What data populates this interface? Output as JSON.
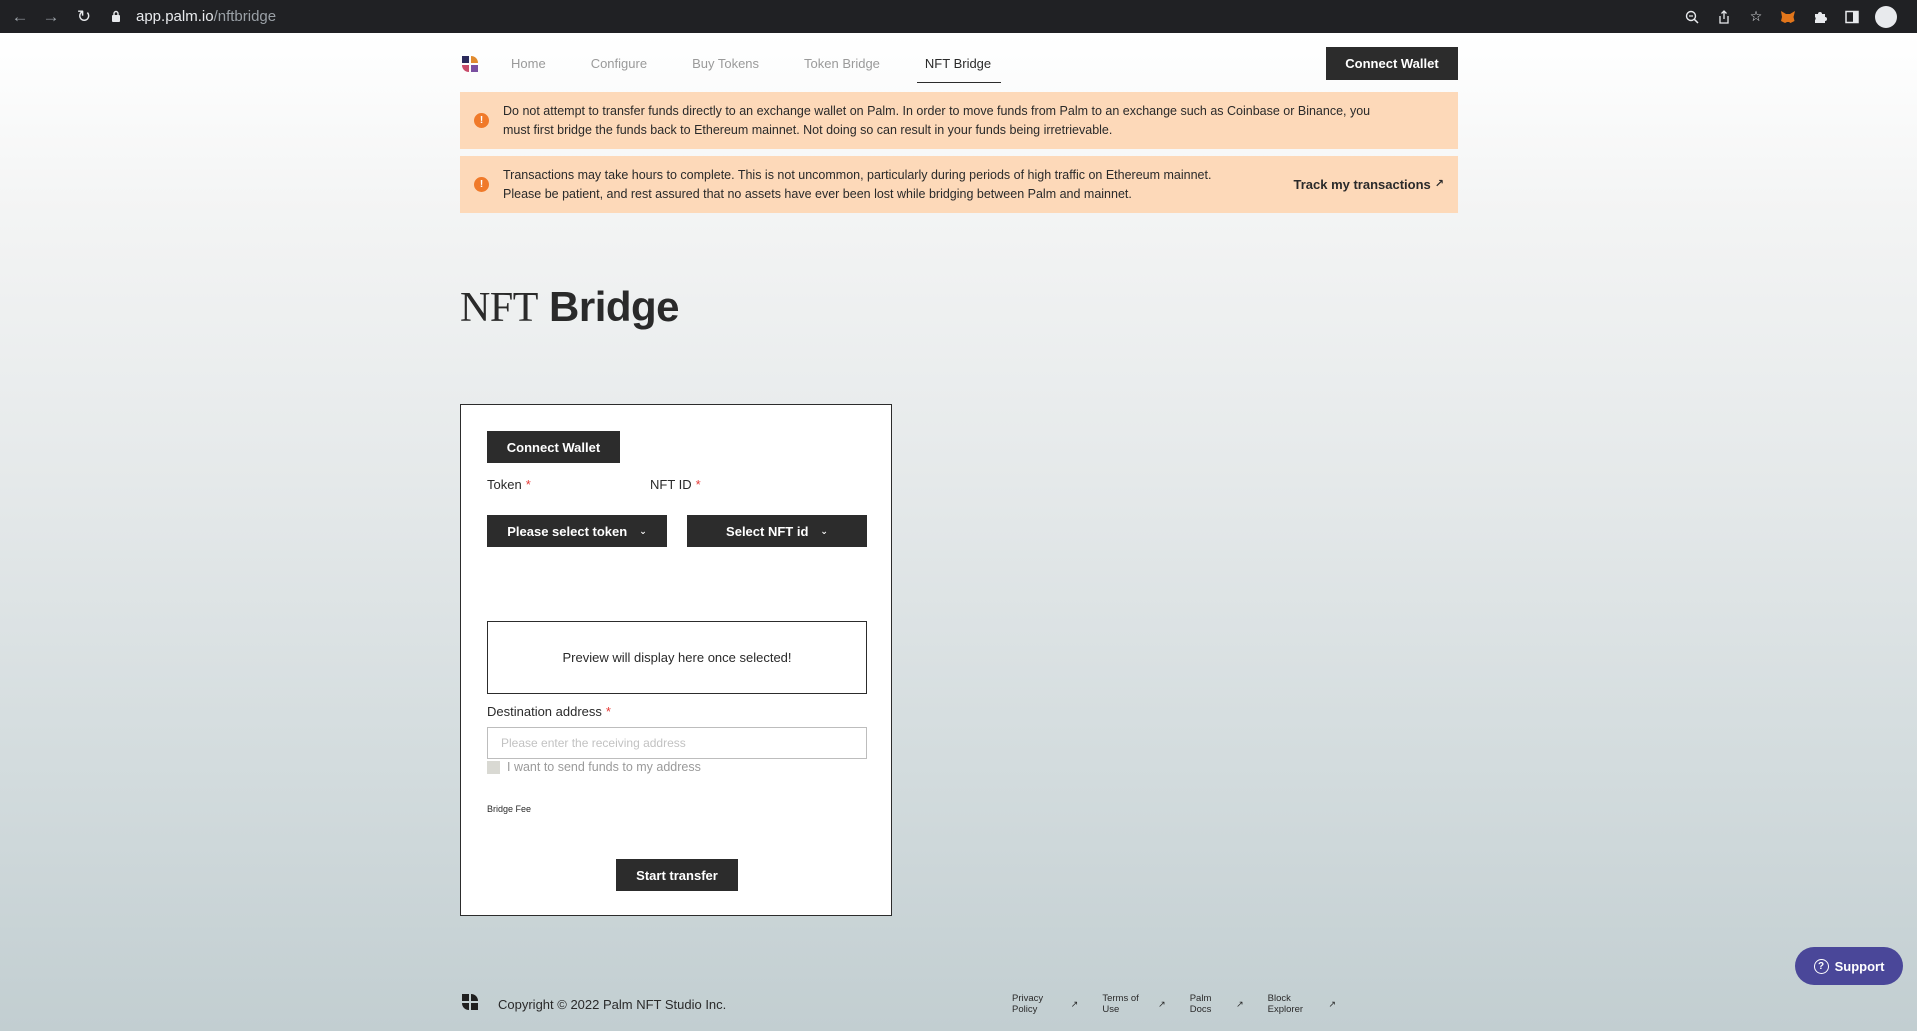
{
  "browser": {
    "url_host": "app.palm.io",
    "url_path": "/nftbridge"
  },
  "nav": {
    "items": [
      {
        "label": "Home"
      },
      {
        "label": "Configure"
      },
      {
        "label": "Buy Tokens"
      },
      {
        "label": "Token Bridge"
      },
      {
        "label": "NFT Bridge",
        "active": true
      }
    ],
    "connect_label": "Connect Wallet"
  },
  "alerts": {
    "exchange_line1": "Do not attempt to transfer funds directly to an exchange wallet on Palm. In order to move funds from Palm to an exchange such as Coinbase or Binance, you",
    "exchange_line2": "must first bridge the funds back to Ethereum mainnet. Not doing so can result in your funds being irretrievable.",
    "time_line1": "Transactions may take hours to complete. This is not uncommon, particularly during periods of high traffic on Ethereum mainnet.",
    "time_line2": "Please be patient, and rest assured that no assets have ever been lost while bridging between Palm and mainnet.",
    "track_label": "Track my transactions"
  },
  "title": {
    "light": "NFT",
    "bold": "Bridge"
  },
  "form": {
    "connect_label": "Connect Wallet",
    "token_label": "Token",
    "token_select": "Please select token",
    "nftid_label": "NFT ID",
    "nftid_select": "Select NFT id",
    "required_mark": "*",
    "preview_text": "Preview will display here once selected!",
    "destination_label": "Destination address",
    "destination_placeholder": "Please enter the receiving address",
    "destination_value": "",
    "self_send_label": "I want to send funds to my address",
    "fee_label": "Bridge Fee",
    "start_label": "Start transfer"
  },
  "support": {
    "label": "Support"
  },
  "footer": {
    "copyright": "Copyright © 2022 Palm NFT Studio Inc.",
    "links": [
      {
        "label": "Privacy Policy"
      },
      {
        "label": "Terms of Use"
      },
      {
        "label": "Palm Docs"
      },
      {
        "label": "Block Explorer"
      }
    ]
  },
  "colors": {
    "alert_bg": "#fdd9b9",
    "warn_icon": "#f07a2a",
    "dark_button": "#2c2c2c",
    "support_button": "#4a4799",
    "required": "#e53935"
  }
}
